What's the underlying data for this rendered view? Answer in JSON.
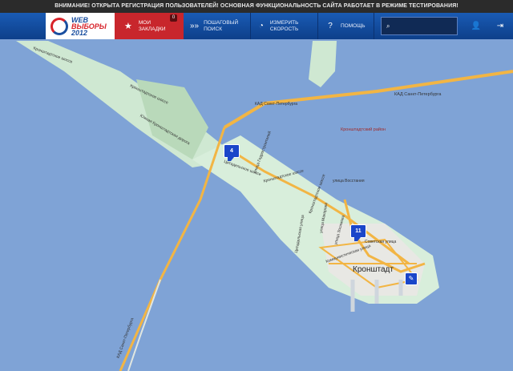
{
  "banner": {
    "text": "ВНИМАНИЕ! ОТКРЫТА РЕГИСТРАЦИЯ ПОЛЬЗОВАТЕЛЕЙ! ОСНОВНАЯ ФУНКЦИОНАЛЬНОСТЬ САЙТА РАБОТАЕТ В РЕЖИМЕ ТЕСТИРОВАНИЯ!"
  },
  "nav": {
    "logo_line1": "WEB",
    "logo_line2": "ВЫБОРЫ",
    "logo_line3": "2012",
    "favorites_label": "МОИ ЗАКЛАДКИ",
    "favorites_count": "0",
    "step_search_label": "ПОШАГОВЫЙ ПОИСК",
    "speed_label": "ИЗМЕРИТЬ СКОРОСТЬ",
    "help_label": "ПОМОЩЬ"
  },
  "map": {
    "city": "Кронштадт",
    "district": "Кронштадтский район",
    "roads": {
      "kad_east": "КАД Санкт-Петербурга",
      "kad_north": "КАД Санкт-Петербурга",
      "kad_south": "КАД Санкт-Петербурга",
      "kronshtadt_shosse": "Кронштадтское шоссе",
      "yuzh_dor": "Южная Кронштадтская дорога",
      "kronsht_shosse2": "Кронштадтское шоссе",
      "tsitadel": "Цитадельское шоссе",
      "kronsht_shosse3": "Кронштадтское шоссе",
      "ul_gidro": "улица Гидростроителей",
      "ul_vos": "улица Восстания",
      "ul_sov": "Советская улица",
      "ul_makarova": "улица Макарова",
      "kronshtadt_shosse4": "Кронштадтское шоссе",
      "ul_zosimova": "улица Зосимова",
      "ul_aviac": "Цитадельская улица",
      "ul_kom": "Коммунистическая улица"
    },
    "markers": {
      "m1": "4",
      "m2": "11"
    }
  },
  "colors": {
    "water": "#7fa3d6",
    "land": "#d8eedb",
    "road": "#f2b544",
    "nav": "#1a5bb4",
    "fav": "#c8262c"
  }
}
